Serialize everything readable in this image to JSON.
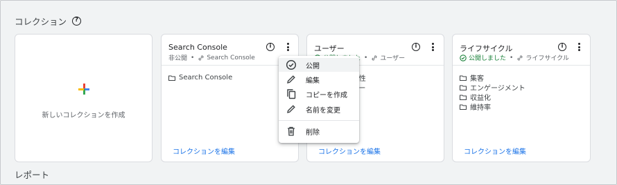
{
  "section": {
    "title": "コレクション",
    "help_icon": "help-circle-icon"
  },
  "new_collection": {
    "label": "新しいコレクションを作成",
    "icon": "plus-icon"
  },
  "cards": [
    {
      "title": "Search Console",
      "status": "非公開",
      "source": "Search Console",
      "items": [
        "Search Console"
      ],
      "edit_label": "コレクションを編集"
    },
    {
      "title": "ユーザー",
      "status": "公開しました",
      "source": "ユーザー",
      "items": [
        "ユーザー属性",
        "テクノロジー"
      ],
      "edit_label": "コレクションを編集"
    },
    {
      "title": "ライフサイクル",
      "status": "公開しました",
      "source": "ライフサイクル",
      "items": [
        "集客",
        "エンゲージメント",
        "収益化",
        "維持率"
      ],
      "edit_label": "コレクションを編集"
    }
  ],
  "menu": {
    "items": [
      {
        "label": "公開",
        "icon": "check-circle-icon"
      },
      {
        "label": "編集",
        "icon": "pencil-icon"
      },
      {
        "label": "コピーを作成",
        "icon": "copy-icon"
      },
      {
        "label": "名前を変更",
        "icon": "pencil-icon"
      },
      {
        "label": "削除",
        "icon": "trash-icon"
      }
    ]
  },
  "reports": {
    "title": "レポート"
  },
  "colors": {
    "link": "#1a73e8",
    "published_green": "#188038",
    "plus_blue": "#4285f4",
    "plus_red": "#ea4335",
    "plus_yellow": "#fbbc04",
    "plus_green": "#34a853"
  }
}
